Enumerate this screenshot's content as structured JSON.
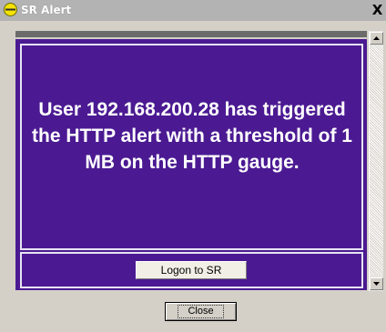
{
  "window": {
    "title": "SR Alert",
    "close_glyph": "X"
  },
  "icons": {
    "app": "app-icon",
    "close": "close-icon",
    "scroll_up": "arrow-up-icon",
    "scroll_down": "arrow-down-icon"
  },
  "alert": {
    "message": "User 192.168.200.28 has triggered the HTTP alert with a threshold of 1 MB on the HTTP gauge.",
    "logon_label": "Logon to SR"
  },
  "footer": {
    "close_label": "Close"
  },
  "colors": {
    "panel_bg": "#4b1a92",
    "panel_text": "#ffffff",
    "window_bg": "#d4d0c8",
    "titlebar_bg": "#b3b3b3"
  }
}
